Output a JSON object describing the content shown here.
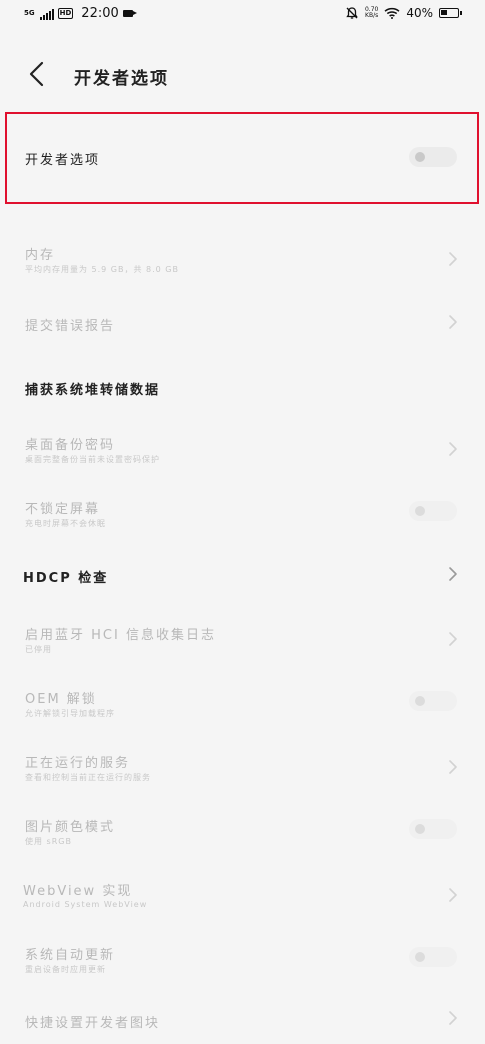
{
  "status_bar": {
    "network": "5G",
    "hd": "HD",
    "time": "22:00",
    "speed_top": "0.70",
    "speed_bottom": "KB/s",
    "battery_pct": "40%"
  },
  "header": {
    "title": "开发者选项"
  },
  "main_toggle": {
    "label": "开发者选项",
    "enabled": false
  },
  "items": [
    {
      "title": "内存",
      "subtitle": "平均内存用量为 5.9 GB，共 8.0 GB"
    },
    {
      "title": "提交错误报告"
    },
    {
      "title": "捕获系统堆转储数据"
    },
    {
      "title": "桌面备份密码",
      "subtitle": "桌面完整备份当前未设置密码保护"
    },
    {
      "title": "不锁定屏幕",
      "subtitle": "充电时屏幕不会休眠"
    },
    {
      "title": "HDCP 检查"
    },
    {
      "title": "启用蓝牙 HCI 信息收集日志",
      "subtitle": "已停用"
    },
    {
      "title": "OEM 解锁",
      "subtitle": "允许解锁引导加载程序"
    },
    {
      "title": "正在运行的服务",
      "subtitle": "查看和控制当前正在运行的服务"
    },
    {
      "title": "图片颜色模式",
      "subtitle": "使用 sRGB"
    },
    {
      "title": "WebView 实现",
      "subtitle": "Android System WebView"
    },
    {
      "title": "系统自动更新",
      "subtitle": "重启设备时应用更新"
    },
    {
      "title": "快捷设置开发者图块"
    }
  ],
  "colors": {
    "highlight": "#e0102e",
    "background": "#f5f5f5"
  }
}
